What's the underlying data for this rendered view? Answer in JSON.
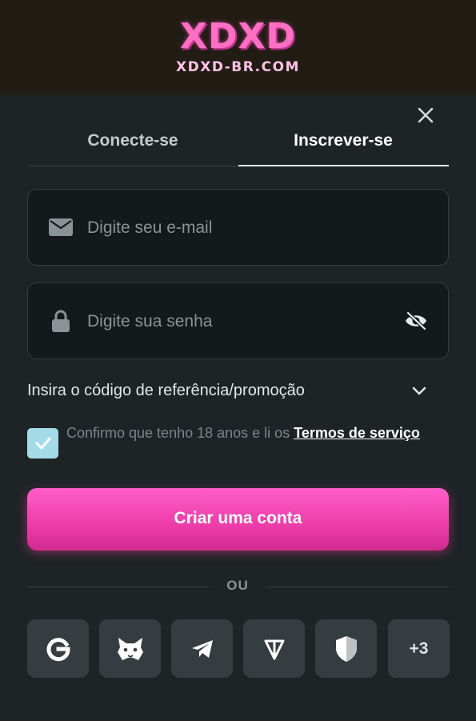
{
  "brand": {
    "logo": "XDXD",
    "domain": "XDXD-BR.COM"
  },
  "dialog": {
    "close_icon": "close-icon"
  },
  "tabs": [
    {
      "label": "Conecte-se",
      "active": false
    },
    {
      "label": "Inscrever-se",
      "active": true
    }
  ],
  "email": {
    "placeholder": "Digite seu e-mail",
    "value": "",
    "icon": "mail-icon"
  },
  "password": {
    "placeholder": "Digite sua senha",
    "value": "",
    "icon": "lock-icon",
    "toggle_icon": "eye-slash-icon"
  },
  "promo": {
    "label": "Insira o código de referência/promoção",
    "icon": "chevron-down-icon"
  },
  "terms": {
    "checked": true,
    "text": "Confirmo que tenho 18 anos e li os ",
    "link": "Termos de serviço"
  },
  "submit": {
    "label": "Criar uma conta"
  },
  "divider": {
    "label": "OU"
  },
  "social": [
    {
      "name": "google",
      "icon": "google-icon"
    },
    {
      "name": "metamask",
      "icon": "metamask-fox-icon"
    },
    {
      "name": "telegram",
      "icon": "telegram-icon"
    },
    {
      "name": "ton",
      "icon": "ton-icon"
    },
    {
      "name": "shield",
      "icon": "shield-icon"
    },
    {
      "name": "more",
      "label": "+3"
    }
  ],
  "colors": {
    "accent": "#ff4fbf",
    "background": "#1e2426",
    "checkbox": "#a4dbe6"
  }
}
